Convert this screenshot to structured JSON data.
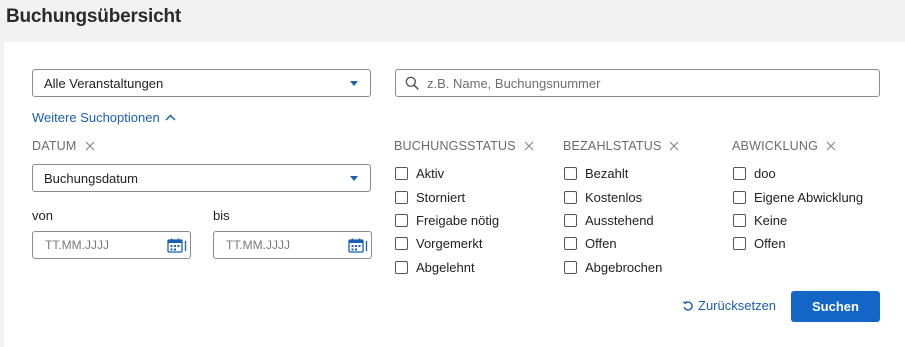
{
  "page": {
    "title": "Buchungsübersicht"
  },
  "filters": {
    "event_select": {
      "value": "Alle Veranstaltungen"
    },
    "search": {
      "placeholder": "z.B. Name, Buchungsnummer",
      "value": ""
    },
    "more_options_label": "Weitere Suchoptionen",
    "date": {
      "heading": "DATUM",
      "type_select": {
        "value": "Buchungsdatum"
      },
      "from_label": "von",
      "to_label": "bis",
      "from_placeholder": "TT.MM.JJJJ",
      "to_placeholder": "TT.MM.JJJJ"
    },
    "groups": [
      {
        "heading": "BUCHUNGSSTATUS",
        "options": [
          {
            "label": "Aktiv",
            "checked": false
          },
          {
            "label": "Storniert",
            "checked": false
          },
          {
            "label": "Freigabe nötig",
            "checked": false
          },
          {
            "label": "Vorgemerkt",
            "checked": false
          },
          {
            "label": "Abgelehnt",
            "checked": false
          }
        ]
      },
      {
        "heading": "BEZAHLSTATUS",
        "options": [
          {
            "label": "Bezahlt",
            "checked": false
          },
          {
            "label": "Kostenlos",
            "checked": false
          },
          {
            "label": "Ausstehend",
            "checked": false
          },
          {
            "label": "Offen",
            "checked": false
          },
          {
            "label": "Abgebrochen",
            "checked": false
          }
        ]
      },
      {
        "heading": "ABWICKLUNG",
        "options": [
          {
            "label": "doo",
            "checked": false
          },
          {
            "label": "Eigene Abwicklung",
            "checked": false
          },
          {
            "label": "Keine",
            "checked": false
          },
          {
            "label": "Offen",
            "checked": false
          }
        ]
      }
    ]
  },
  "actions": {
    "reset_label": "Zurücksetzen",
    "search_label": "Suchen"
  },
  "colors": {
    "accent": "#1366c6",
    "link": "#1a5fb4",
    "background": "#f2f2f2",
    "panel": "#ffffff"
  }
}
